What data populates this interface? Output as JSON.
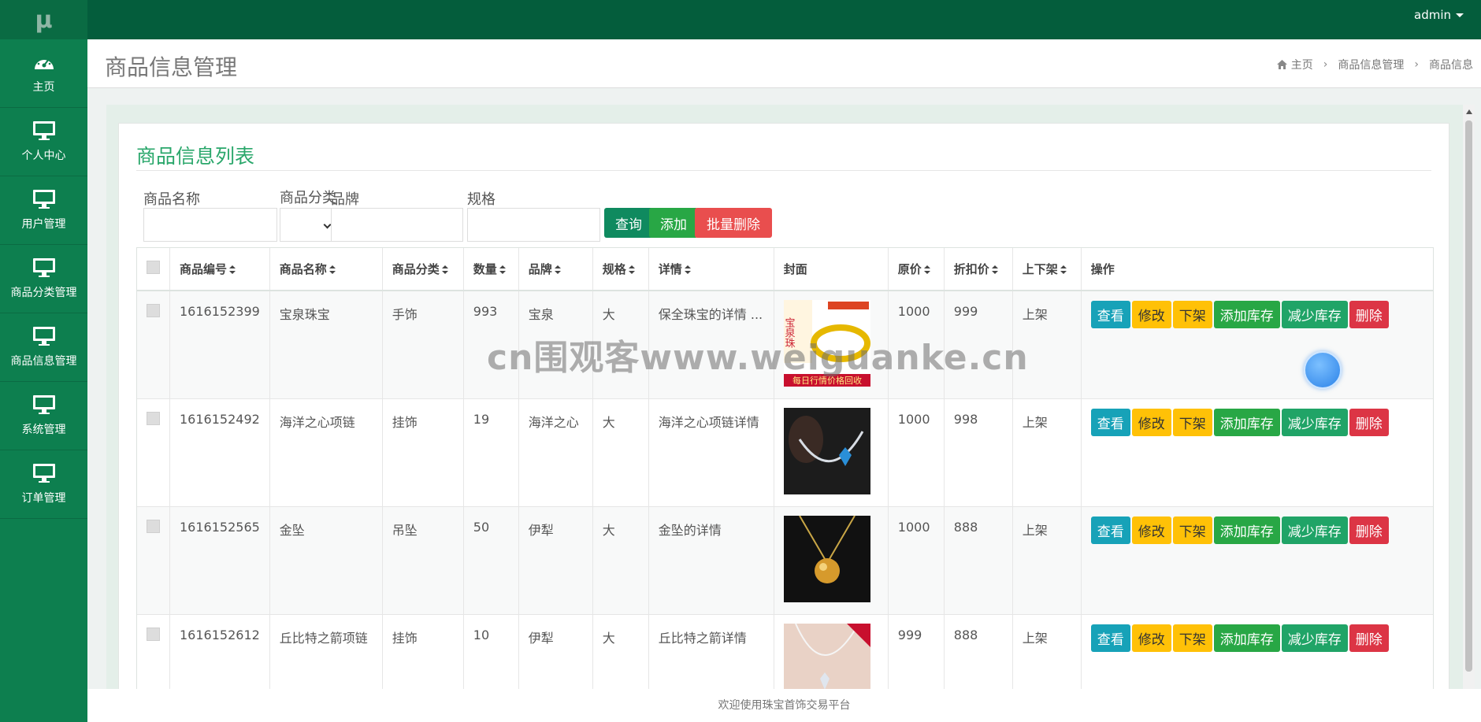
{
  "app": {
    "logo": "μ",
    "user": "admin"
  },
  "nav": [
    {
      "label": "主页",
      "icon": "dashboard-icon"
    },
    {
      "label": "个人中心",
      "icon": "monitor-icon"
    },
    {
      "label": "用户管理",
      "icon": "monitor-icon"
    },
    {
      "label": "商品分类管理",
      "icon": "monitor-icon"
    },
    {
      "label": "商品信息管理",
      "icon": "monitor-icon"
    },
    {
      "label": "系统管理",
      "icon": "monitor-icon"
    },
    {
      "label": "订单管理",
      "icon": "monitor-icon"
    }
  ],
  "header": {
    "title": "商品信息管理",
    "breadcrumb": [
      "主页",
      "商品信息管理",
      "商品信息"
    ]
  },
  "card": {
    "title": "商品信息列表"
  },
  "search": {
    "name_label": "商品名称",
    "category_label": "商品分类",
    "brand_label": "品牌",
    "spec_label": "规格",
    "query_button": "查询",
    "add_button": "添加",
    "batch_delete_button": "批量删除"
  },
  "table": {
    "columns": [
      "商品编号",
      "商品名称",
      "商品分类",
      "数量",
      "品牌",
      "规格",
      "详情",
      "封面",
      "原价",
      "折扣价",
      "上下架",
      "操作"
    ],
    "actions": [
      "查看",
      "修改",
      "下架",
      "添加库存",
      "减少库存",
      "删除"
    ],
    "rows": [
      {
        "id": "1616152399",
        "name": "宝泉珠宝",
        "category": "手饰",
        "qty": "993",
        "brand": "宝泉",
        "spec": "大",
        "detail": "保全珠宝的详情 ...",
        "price": "1000",
        "discount": "999",
        "status": "上架",
        "cover_text": "宝泉珠",
        "cover_banner": "每日行情价格回收"
      },
      {
        "id": "1616152492",
        "name": "海洋之心项链",
        "category": "挂饰",
        "qty": "19",
        "brand": "海洋之心",
        "spec": "大",
        "detail": "海洋之心项链详情",
        "price": "1000",
        "discount": "998",
        "status": "上架",
        "cover_text": "",
        "cover_banner": ""
      },
      {
        "id": "1616152565",
        "name": "金坠",
        "category": "吊坠",
        "qty": "50",
        "brand": "伊犁",
        "spec": "大",
        "detail": "金坠的详情",
        "price": "1000",
        "discount": "888",
        "status": "上架",
        "cover_text": "",
        "cover_banner": ""
      },
      {
        "id": "1616152612",
        "name": "丘比特之箭项链",
        "category": "挂饰",
        "qty": "10",
        "brand": "伊犁",
        "spec": "大",
        "detail": "丘比特之箭详情",
        "price": "999",
        "discount": "888",
        "status": "上架",
        "cover_text": "",
        "cover_banner": ""
      }
    ]
  },
  "watermark": "cn围观客www.weiguanke.cn",
  "footer": "欢迎使用珠宝首饰交易平台",
  "colors": {
    "topbar": "#045d3c",
    "sidebar": "#0d7f4f",
    "accent": "#2aa76b",
    "query": "#0f8a5f",
    "add": "#28a745",
    "delete": "#dc3545"
  }
}
